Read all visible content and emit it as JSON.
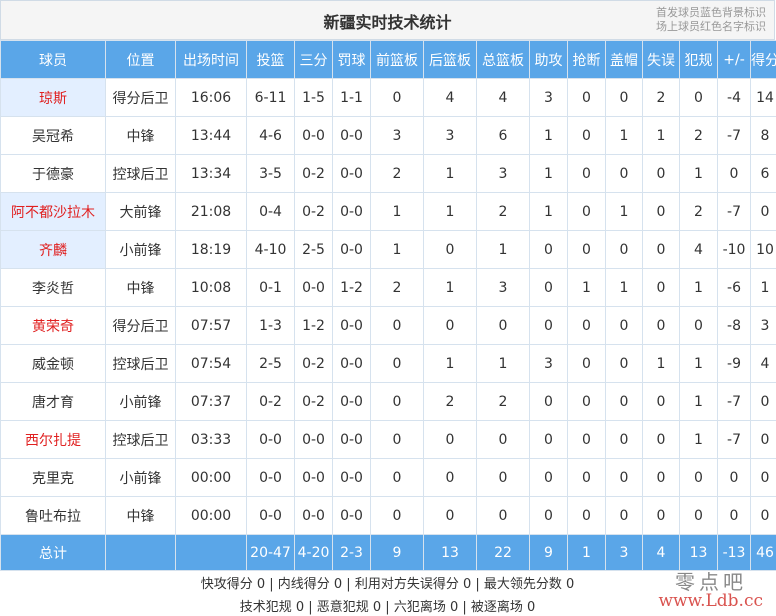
{
  "title": "新疆实时技术统计",
  "legend": [
    "首发球员蓝色背景标识",
    "场上球员红色名字标识"
  ],
  "columns": [
    "球员",
    "位置",
    "出场时间",
    "投篮",
    "三分",
    "罚球",
    "前篮板",
    "后篮板",
    "总篮板",
    "助攻",
    "抢断",
    "盖帽",
    "失误",
    "犯规",
    "+/-",
    "得分"
  ],
  "players": [
    {
      "name": "琼斯",
      "pos": "得分后卫",
      "min": "16:06",
      "fg": "6-11",
      "tp": "1-5",
      "ft": "1-1",
      "oreb": "0",
      "dreb": "4",
      "reb": "4",
      "ast": "3",
      "stl": "0",
      "blk": "0",
      "tov": "2",
      "pf": "0",
      "pm": "-4",
      "pts": "14",
      "starter": true,
      "oncourt": true
    },
    {
      "name": "吴冠希",
      "pos": "中锋",
      "min": "13:44",
      "fg": "4-6",
      "tp": "0-0",
      "ft": "0-0",
      "oreb": "3",
      "dreb": "3",
      "reb": "6",
      "ast": "1",
      "stl": "0",
      "blk": "1",
      "tov": "1",
      "pf": "2",
      "pm": "-7",
      "pts": "8",
      "starter": false,
      "oncourt": false
    },
    {
      "name": "于德豪",
      "pos": "控球后卫",
      "min": "13:34",
      "fg": "3-5",
      "tp": "0-2",
      "ft": "0-0",
      "oreb": "2",
      "dreb": "1",
      "reb": "3",
      "ast": "1",
      "stl": "0",
      "blk": "0",
      "tov": "0",
      "pf": "1",
      "pm": "0",
      "pts": "6",
      "starter": false,
      "oncourt": false
    },
    {
      "name": "阿不都沙拉木",
      "pos": "大前锋",
      "min": "21:08",
      "fg": "0-4",
      "tp": "0-2",
      "ft": "0-0",
      "oreb": "1",
      "dreb": "1",
      "reb": "2",
      "ast": "1",
      "stl": "0",
      "blk": "1",
      "tov": "0",
      "pf": "2",
      "pm": "-7",
      "pts": "0",
      "starter": true,
      "oncourt": true
    },
    {
      "name": "齐麟",
      "pos": "小前锋",
      "min": "18:19",
      "fg": "4-10",
      "tp": "2-5",
      "ft": "0-0",
      "oreb": "1",
      "dreb": "0",
      "reb": "1",
      "ast": "0",
      "stl": "0",
      "blk": "0",
      "tov": "0",
      "pf": "4",
      "pm": "-10",
      "pts": "10",
      "starter": true,
      "oncourt": true
    },
    {
      "name": "李炎哲",
      "pos": "中锋",
      "min": "10:08",
      "fg": "0-1",
      "tp": "0-0",
      "ft": "1-2",
      "oreb": "2",
      "dreb": "1",
      "reb": "3",
      "ast": "0",
      "stl": "1",
      "blk": "1",
      "tov": "0",
      "pf": "1",
      "pm": "-6",
      "pts": "1",
      "starter": false,
      "oncourt": false
    },
    {
      "name": "黄荣奇",
      "pos": "得分后卫",
      "min": "07:57",
      "fg": "1-3",
      "tp": "1-2",
      "ft": "0-0",
      "oreb": "0",
      "dreb": "0",
      "reb": "0",
      "ast": "0",
      "stl": "0",
      "blk": "0",
      "tov": "0",
      "pf": "0",
      "pm": "-8",
      "pts": "3",
      "starter": false,
      "oncourt": true
    },
    {
      "name": "威金顿",
      "pos": "控球后卫",
      "min": "07:54",
      "fg": "2-5",
      "tp": "0-2",
      "ft": "0-0",
      "oreb": "0",
      "dreb": "1",
      "reb": "1",
      "ast": "3",
      "stl": "0",
      "blk": "0",
      "tov": "1",
      "pf": "1",
      "pm": "-9",
      "pts": "4",
      "starter": false,
      "oncourt": false
    },
    {
      "name": "唐才育",
      "pos": "小前锋",
      "min": "07:37",
      "fg": "0-2",
      "tp": "0-2",
      "ft": "0-0",
      "oreb": "0",
      "dreb": "2",
      "reb": "2",
      "ast": "0",
      "stl": "0",
      "blk": "0",
      "tov": "0",
      "pf": "1",
      "pm": "-7",
      "pts": "0",
      "starter": false,
      "oncourt": false
    },
    {
      "name": "西尔扎提",
      "pos": "控球后卫",
      "min": "03:33",
      "fg": "0-0",
      "tp": "0-0",
      "ft": "0-0",
      "oreb": "0",
      "dreb": "0",
      "reb": "0",
      "ast": "0",
      "stl": "0",
      "blk": "0",
      "tov": "0",
      "pf": "1",
      "pm": "-7",
      "pts": "0",
      "starter": false,
      "oncourt": true
    },
    {
      "name": "克里克",
      "pos": "小前锋",
      "min": "00:00",
      "fg": "0-0",
      "tp": "0-0",
      "ft": "0-0",
      "oreb": "0",
      "dreb": "0",
      "reb": "0",
      "ast": "0",
      "stl": "0",
      "blk": "0",
      "tov": "0",
      "pf": "0",
      "pm": "0",
      "pts": "0",
      "starter": false,
      "oncourt": false
    },
    {
      "name": "鲁吐布拉",
      "pos": "中锋",
      "min": "00:00",
      "fg": "0-0",
      "tp": "0-0",
      "ft": "0-0",
      "oreb": "0",
      "dreb": "0",
      "reb": "0",
      "ast": "0",
      "stl": "0",
      "blk": "0",
      "tov": "0",
      "pf": "0",
      "pm": "0",
      "pts": "0",
      "starter": false,
      "oncourt": false
    }
  ],
  "totals": {
    "label": "总计",
    "pos": "",
    "min": "",
    "fg": "20-47",
    "tp": "4-20",
    "ft": "2-3",
    "oreb": "9",
    "dreb": "13",
    "reb": "22",
    "ast": "9",
    "stl": "1",
    "blk": "3",
    "tov": "4",
    "pf": "13",
    "pm": "-13",
    "pts": "46"
  },
  "footer": {
    "line1": "快攻得分 0 | 内线得分 0 | 利用对方失误得分 0 | 最大领先分数 0",
    "line2": "技术犯规 0 | 恶意犯规 0 | 六犯离场 0 | 被逐离场 0"
  },
  "watermark": {
    "cn": "零点吧",
    "url": "www.Ldb.cc"
  },
  "colors": {
    "header_bg": "#5aa6e8",
    "starter_bg": "#e3efff",
    "oncourt_text": "#e02020"
  }
}
